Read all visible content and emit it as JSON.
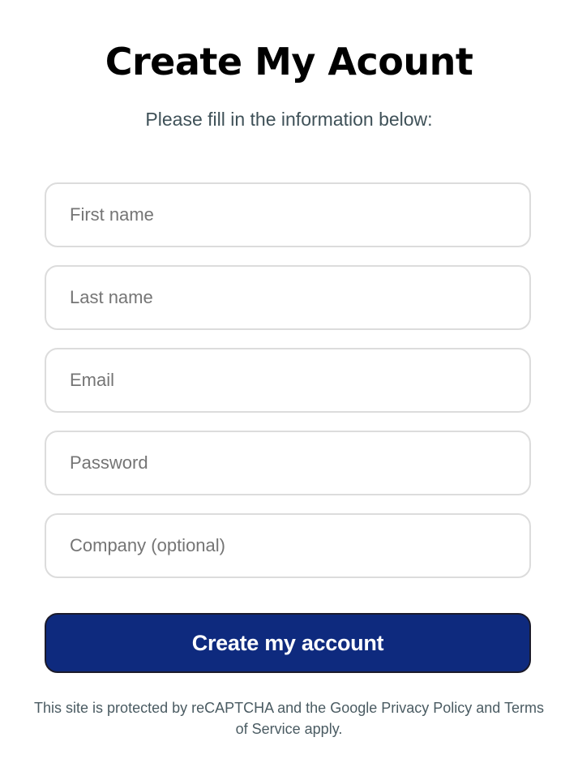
{
  "form": {
    "title": "Create My Acount",
    "subtitle": "Please fill in the information below:",
    "fields": {
      "first_name": {
        "placeholder": "First name",
        "value": ""
      },
      "last_name": {
        "placeholder": "Last name",
        "value": ""
      },
      "email": {
        "placeholder": "Email",
        "value": ""
      },
      "password": {
        "placeholder": "Password",
        "value": ""
      },
      "company": {
        "placeholder": "Company (optional)",
        "value": ""
      }
    },
    "submit_label": "Create my account",
    "recaptcha_notice": "This site is protected by reCAPTCHA and the Google Privacy Policy and Terms of Service apply."
  },
  "colors": {
    "button_background": "#0e2a7e",
    "button_text": "#ffffff",
    "field_border": "#dcdcdc",
    "subtitle_text": "#3f5158"
  }
}
